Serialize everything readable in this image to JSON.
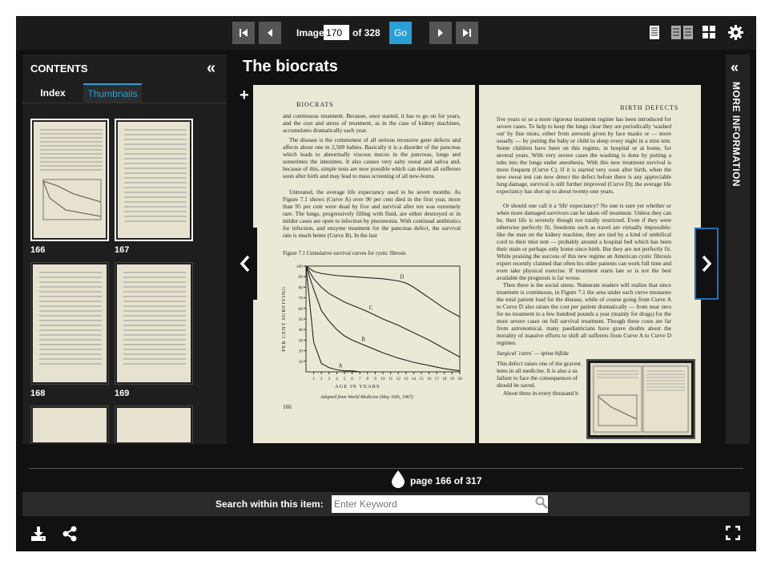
{
  "toolbar": {
    "image_label": "Image",
    "image_value": "170",
    "of_label": "of 328",
    "go_label": "Go"
  },
  "sidebar": {
    "title": "CONTENTS",
    "tabs": [
      "Index",
      "Thumbnails"
    ],
    "active_tab": "Thumbnails",
    "thumbnails": [
      {
        "label": "166",
        "selected": true
      },
      {
        "label": "167",
        "selected": true
      },
      {
        "label": "168",
        "selected": false
      },
      {
        "label": "169",
        "selected": false
      },
      {
        "label": "",
        "selected": false
      },
      {
        "label": "",
        "selected": false
      }
    ]
  },
  "book": {
    "title": "The biocrats",
    "left_page": {
      "header": "BIOCRATS",
      "para1": "and continuous treatment. Because, once started, it has to go on for years, and the cost and stress of treatment, as in the case of kidney machines, accumulates dramatically each year.",
      "para2": "The disease is the commonest of all serious recessive gene defects and affects about one in 2,500 babies. Basically it is a disorder of the pancreas which leads to abnormally viscous mucus in the pancreas, lungs and sometimes the intestines. It also causes very salty sweat and saliva and, because of this, simple tests are now possible which can detect all sufferers soon after birth and may lead to mass screening of all new-borns.",
      "para3": "Untreated, the average life expectancy used to be seven months. As Figure 7.1 shows (Curve A) over 90 per cent died in the first year, more than 95 per cent were dead by five and survival after ten was extremely rare. The lungs, progressively filling with fluid, are either destroyed or in milder cases are open to infection by pneumonia. With continual antibiotics for infection, and enzyme treatment for the pancreas defect, the survival rate is much better (Curve B). In the last",
      "figure_caption": "Figure 7.1 Cumulative survival curves for cystic fibrosis",
      "chart_ylabel": "PER CENT SURVIVING",
      "chart_xlabel": "AGE IN YEARS",
      "chart_credit": "Adapted from World Medicine (May 16th, 1967)",
      "page_number": "166"
    },
    "right_page": {
      "header": "BIRTH DEFECTS",
      "para1": "five years or so a more rigorous treatment regime has been introduced for severe cases. To help to keep the lungs clear they are periodically 'washed out' by fine mists, either from aerosols given by face masks or — more usually — by putting the baby or child to sleep every night in a mist tent. Some children have been on this regime, in hospital or at home, for several years. With very severe cases the washing is done by putting a tube into the lungs under anesthesia. With this new treatment survival is more frequent (Curve C). If it is started very soon after birth, when the new sweat test can now detect the defect before there is any appreciable lung damage, survival is still further improved (Curve D); the average life expectancy has shot up to about twenty-one years.",
      "para2": "Or should one call it a 'life' expectancy? No one is sure yet whether or when more damaged survivors can be taken off treatment. Unless they can be, their life is severely though not totally restricted. Even if they were otherwise perfectly fit, freedoms such as travel are virtually impossible: like the man on the kidney machine, they are tied by a kind of umbilical cord to their mist tent — probably around a hospital bed which has been their main or perhaps only home since birth. But they are not perfectly fit. While praising the success of this new regime an American cystic fibrosis expert recently claimed that often his older patients can work full time and even take physical exercise. If treatment starts late or is not the best available the prognosis is far worse.",
      "para3": "Then there is the social stress. Numerate readers will realize that since treatment is continuous, in Figure 7.1 the area under each curve measures the total patient load for the disease, while of course going from Curve A to Curve D also raises the cost per patient dramatically — from near zero for no treatment to a few hundred pounds a year (mainly for drugs) for the most severe cases on full survival treatment. Though these costs are far from astronomical, many paediatricians have grave doubts about the morality of massive efforts to shift all sufferers from Curve A to Curve D regimes.",
      "subhead": "Surgical 'cures' — spina bifida",
      "para4": "This defect raises one of the gravest lems in all medicine. It is also a su failure to face the consequences of should be saved.",
      "para5": "About three in every thousand b"
    }
  },
  "chart_data": {
    "type": "line",
    "xlabel": "AGE IN YEARS",
    "ylabel": "PER CENT SURVIVING",
    "x": [
      1,
      2,
      3,
      4,
      5,
      6,
      7,
      8,
      9,
      10,
      11,
      12,
      13,
      14,
      15,
      16,
      17,
      18,
      19,
      20
    ],
    "y_ticks": [
      0,
      10,
      20,
      30,
      40,
      50,
      60,
      70,
      80,
      90,
      100
    ],
    "xlim": [
      0,
      20
    ],
    "ylim": [
      0,
      100
    ],
    "series": [
      {
        "name": "A",
        "x": [
          0,
          1,
          2,
          3,
          4,
          5,
          6,
          7,
          8
        ],
        "values": [
          100,
          28,
          8,
          4,
          2,
          1,
          1,
          0,
          0
        ]
      },
      {
        "name": "B",
        "x": [
          0,
          1,
          2,
          3,
          4,
          5,
          6,
          7,
          8,
          10,
          12,
          14,
          16,
          18,
          20
        ],
        "values": [
          100,
          78,
          58,
          48,
          40,
          34,
          30,
          27,
          24,
          18,
          13,
          9,
          6,
          3,
          1
        ]
      },
      {
        "name": "C",
        "x": [
          0,
          1,
          2,
          3,
          4,
          5,
          6,
          8,
          10,
          12,
          14,
          16,
          18,
          20
        ],
        "values": [
          100,
          88,
          80,
          74,
          70,
          66,
          63,
          57,
          50,
          44,
          37,
          30,
          22,
          14
        ]
      },
      {
        "name": "D",
        "x": [
          0,
          1,
          2,
          4,
          6,
          8,
          10,
          12,
          13,
          14,
          15,
          16,
          17,
          18,
          20
        ],
        "values": [
          100,
          95,
          93,
          91,
          90,
          89,
          88,
          86,
          84,
          80,
          75,
          70,
          65,
          60,
          52
        ]
      }
    ]
  },
  "navigation": {
    "page_indicator": "page 166 of 317"
  },
  "right_panel": {
    "label": "MORE INFORMATION"
  },
  "search": {
    "label": "Search within this item:",
    "placeholder": "Enter Keyword"
  },
  "icons": {
    "first": "first-page-icon",
    "prev": "previous-page-icon",
    "next": "next-page-icon",
    "last": "last-page-icon",
    "single": "single-page-view-icon",
    "double": "two-page-view-icon",
    "grid": "grid-view-icon",
    "settings": "gear-icon",
    "download": "download-icon",
    "share": "share-icon",
    "fullscreen": "fullscreen-icon"
  }
}
